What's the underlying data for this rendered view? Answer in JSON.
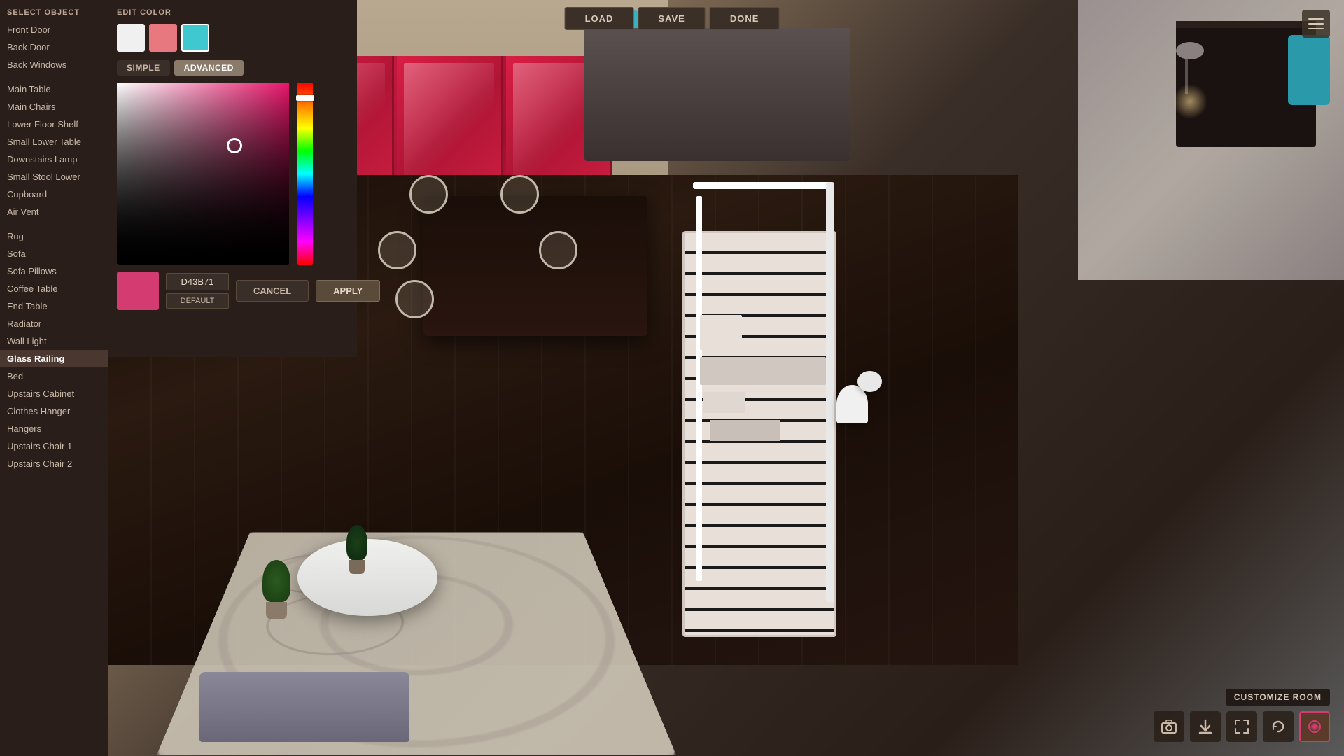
{
  "sidebar": {
    "header": "SELECT OBJECT",
    "items": [
      {
        "label": "Front Door",
        "active": false
      },
      {
        "label": "Back Door",
        "active": false
      },
      {
        "label": "Back Windows",
        "active": false
      },
      {
        "label": "Main Table",
        "active": false
      },
      {
        "label": "Main Chairs",
        "active": false
      },
      {
        "label": "Lower Floor Shelf",
        "active": false
      },
      {
        "label": "Small Lower Table",
        "active": false
      },
      {
        "label": "Downstairs Lamp",
        "active": false
      },
      {
        "label": "Small Stool Lower",
        "active": false
      },
      {
        "label": "Cupboard",
        "active": false
      },
      {
        "label": "Air Vent",
        "active": false
      },
      {
        "label": "Rug",
        "active": false
      },
      {
        "label": "Sofa",
        "active": false
      },
      {
        "label": "Sofa Pillows",
        "active": false
      },
      {
        "label": "Coffee Table",
        "active": false
      },
      {
        "label": "End Table",
        "active": false
      },
      {
        "label": "Radiator",
        "active": false
      },
      {
        "label": "Wall Light",
        "active": false
      },
      {
        "label": "Glass Railing",
        "active": true
      },
      {
        "label": "Bed",
        "active": false
      },
      {
        "label": "Upstairs Cabinet",
        "active": false
      },
      {
        "label": "Clothes Hanger",
        "active": false
      },
      {
        "label": "Hangers",
        "active": false
      },
      {
        "label": "Upstairs Chair 1",
        "active": false
      },
      {
        "label": "Upstairs Chair 2",
        "active": false
      }
    ]
  },
  "color_panel": {
    "header": "EDIT COLOR",
    "swatches": [
      {
        "color": "#f0f0f0",
        "selected": false
      },
      {
        "color": "#e87880",
        "selected": false
      },
      {
        "color": "#40c8d0",
        "selected": true
      }
    ],
    "modes": {
      "simple": "SIMPLE",
      "advanced": "ADVANCED",
      "active": "advanced"
    },
    "hex_value": "D43B71",
    "default_btn": "DEFAULT",
    "cancel_btn": "CANCEL",
    "apply_btn": "APPLY"
  },
  "toolbar": {
    "load": "LOAD",
    "save": "SAVE",
    "done": "DONE"
  },
  "bottom_toolbar": {
    "customize_label": "CUSTOMIZE ROOM",
    "icons": [
      "📷",
      "⬇",
      "↕",
      "🔄",
      "🎨"
    ]
  }
}
